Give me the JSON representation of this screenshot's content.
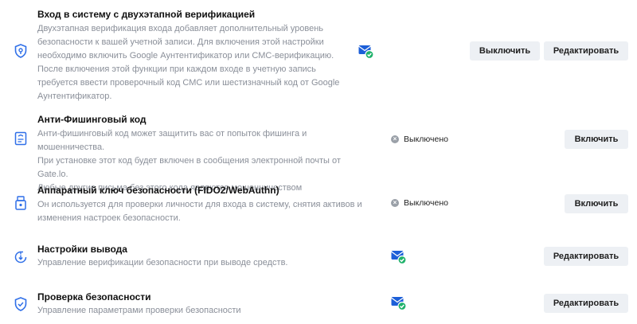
{
  "colors": {
    "brand": "#2f6fe8",
    "success": "#20b26b",
    "button_bg": "#edf0f4",
    "muted_text": "#8a8f99"
  },
  "sections": [
    {
      "icon": "shield-key-icon",
      "title": "Вход в систему с двухэтапной верификацией",
      "desc_lines": [
        "Двухэтапная верификация входа добавляет дополнительный уровень",
        "безопасности к вашей учетной записи. Для включения этой настройки",
        "необходимо включить Google Аунтентификатор или СМС-верификацию.",
        "После включения этой функции при каждом входе в учетную запись",
        "требуется ввести проверочный код СМС или шестизначный код от Google",
        "Аунтентификатор."
      ],
      "status_icon": "mail-check-icon",
      "buttons": [
        "Выключить",
        "Редактировать"
      ]
    },
    {
      "icon": "anti-phishing-icon",
      "title": "Анти-Фишинговый код",
      "desc_lines": [
        "Анти-фишинговый код может защитить вас от попыток фишинга и мошенничества.",
        "При установке этот код будет включен в сообщения электронной почты от Gate.lo.",
        "Любые другие письма без этого кода являются мошенничеством"
      ],
      "status": "Выключено",
      "buttons": [
        "Включить"
      ]
    },
    {
      "icon": "hardware-key-icon",
      "title": "Аппаратный ключ безопасности (FIDO2/WebAuthn)",
      "desc_lines": [
        "Он используется для проверки личности для входа в систему, снятия активов и",
        "изменения настроек безопасности."
      ],
      "status": "Выключено",
      "buttons": [
        "Включить"
      ]
    },
    {
      "icon": "withdraw-settings-icon",
      "title": "Настройки вывода",
      "desc_lines": [
        "Управление верификации безопасности при выводе средств."
      ],
      "status_icon": "mail-check-icon",
      "buttons": [
        "Редактировать"
      ]
    },
    {
      "icon": "shield-check-icon",
      "title": "Проверка безопасности",
      "desc_lines": [
        "Управление параметрами проверки безопасности"
      ],
      "status_icon": "mail-check-icon",
      "buttons": [
        "Редактировать"
      ]
    }
  ]
}
